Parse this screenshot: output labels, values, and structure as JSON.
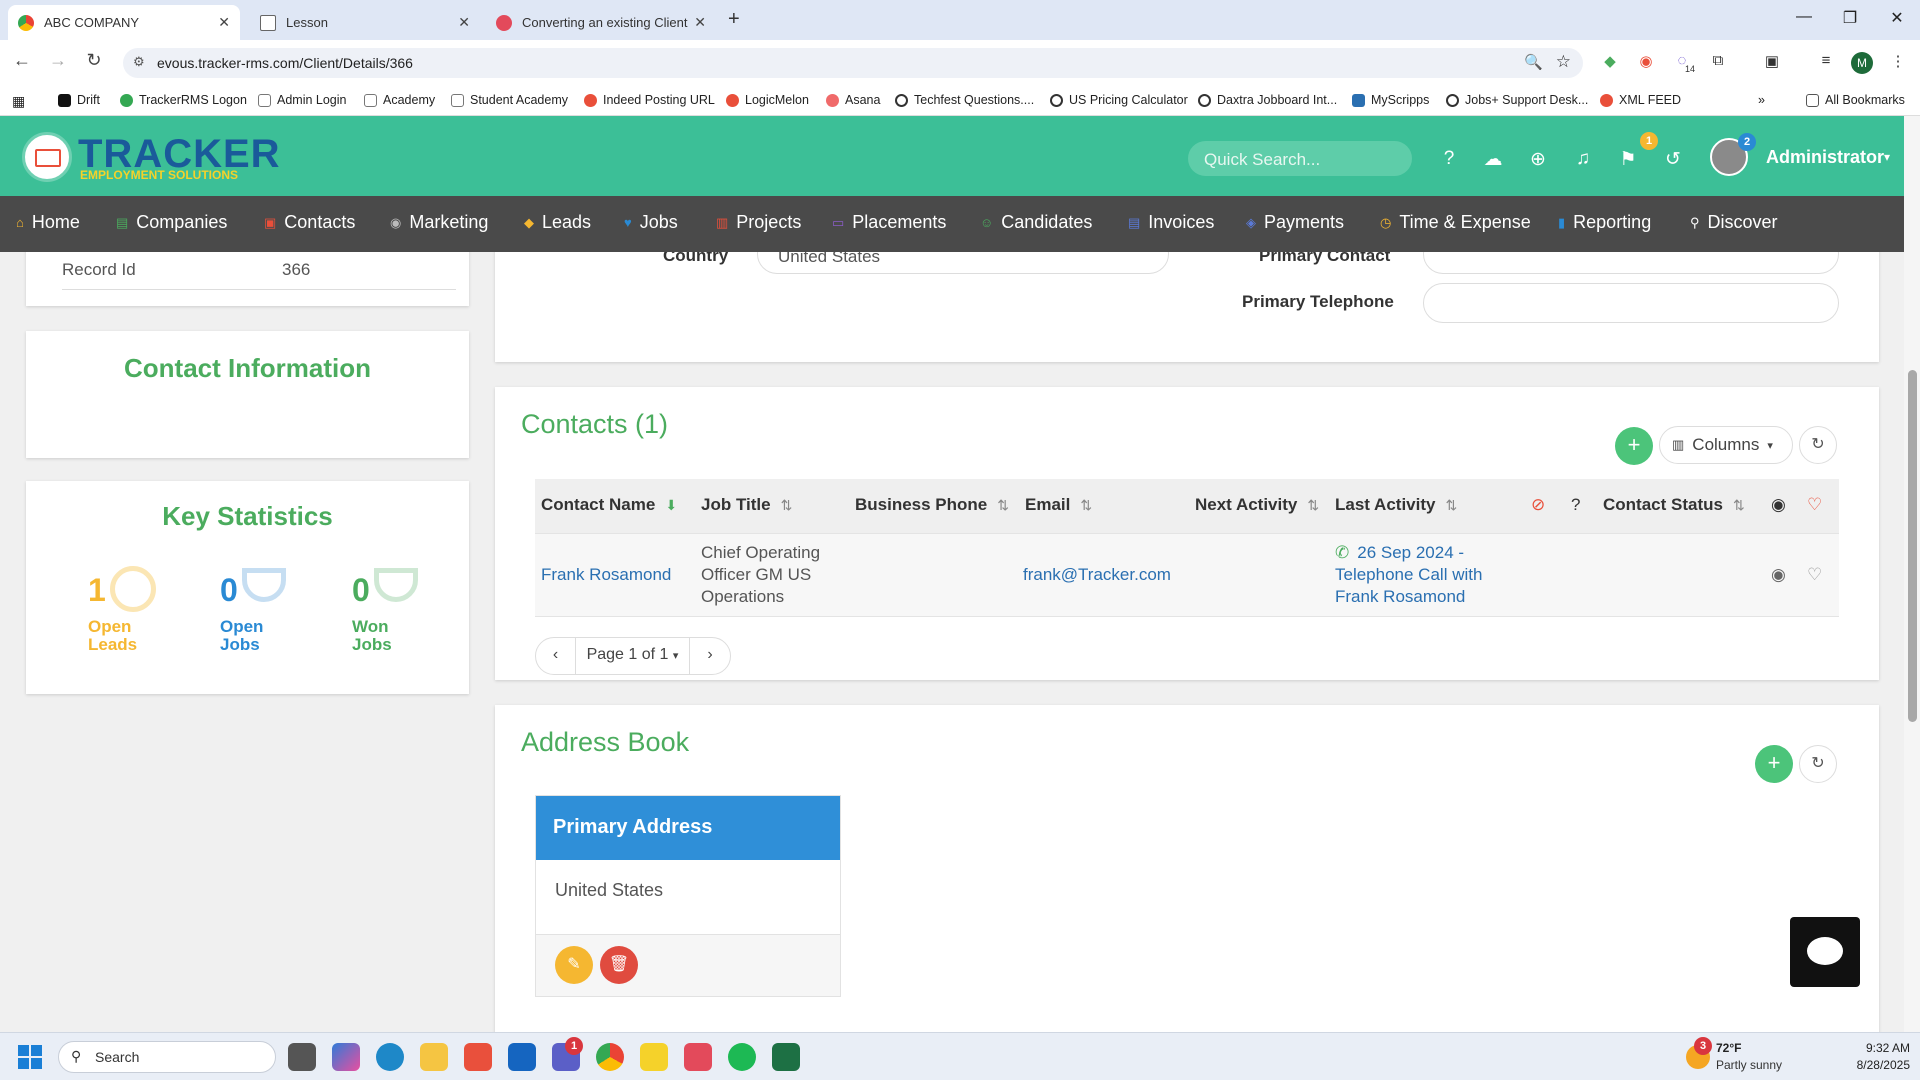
{
  "browser": {
    "tabs": [
      {
        "title": "ABC COMPANY",
        "active": true
      },
      {
        "title": "Lesson",
        "active": false
      },
      {
        "title": "Converting an existing Client Re",
        "active": false
      }
    ],
    "url": "evous.tracker-rms.com/Client/Details/366",
    "profile_initial": "M",
    "ext_badge": "14",
    "bookmarks": [
      "Drift",
      "TrackerRMS Logon",
      "Admin Login",
      "Academy",
      "Student Academy",
      "Indeed Posting URL",
      "LogicMelon",
      "Asana",
      "Techfest Questions....",
      "US Pricing Calculator",
      "Daxtra Jobboard Int...",
      "MyScripps",
      "Jobs+ Support Desk...",
      "XML FEED"
    ],
    "all_bookmarks": "All Bookmarks"
  },
  "app": {
    "logo_main": "TRACKER",
    "logo_sub": "EMPLOYMENT SOLUTIONS",
    "quick_search_placeholder": "Quick Search...",
    "user_name": "Administrator",
    "flag_badge": "1",
    "avatar_badge": "2",
    "menu": [
      "Home",
      "Companies",
      "Contacts",
      "Marketing",
      "Leads",
      "Jobs",
      "Projects",
      "Placements",
      "Candidates",
      "Invoices",
      "Payments",
      "Time & Expense",
      "Reporting",
      "Discover"
    ]
  },
  "left": {
    "record_id_label": "Record Id",
    "record_id_value": "366",
    "contact_info_title": "Contact Information",
    "key_stats_title": "Key Statistics",
    "stats": [
      {
        "value": "1",
        "line1": "Open",
        "line2": "Leads",
        "color": "#f5b731"
      },
      {
        "value": "0",
        "line1": "Open",
        "line2": "Jobs",
        "color": "#2a8ad4"
      },
      {
        "value": "0",
        "line1": "Won",
        "line2": "Jobs",
        "color": "#4bac5e"
      }
    ]
  },
  "details": {
    "country_label": "Country",
    "country_value": "United States",
    "primary_contact_label": "Primary Contact",
    "primary_telephone_label": "Primary Telephone"
  },
  "contacts": {
    "title": "Contacts (1)",
    "columns_label": "Columns",
    "headers": [
      "Contact Name",
      "Job Title",
      "Business Phone",
      "Email",
      "Next Activity",
      "Last Activity",
      "Contact Status"
    ],
    "rows": [
      {
        "name": "Frank Rosamond",
        "job_title_lines": [
          "Chief Operating",
          "Officer GM US",
          "Operations"
        ],
        "business_phone": "",
        "email": "frank@Tracker.com",
        "next_activity": "",
        "last_activity_lines": [
          "26 Sep 2024 -",
          "Telephone Call with",
          "Frank Rosamond"
        ],
        "status": ""
      }
    ],
    "pagination": "Page 1 of 1"
  },
  "address_book": {
    "title": "Address Book",
    "card_title": "Primary Address",
    "card_value": "United States"
  },
  "taskbar": {
    "search_placeholder": "Search",
    "weather_temp": "72°F",
    "weather_desc": "Partly sunny",
    "weather_badge": "3",
    "teams_badge": "1",
    "time": "9:32 AM",
    "date": "8/28/2025"
  }
}
